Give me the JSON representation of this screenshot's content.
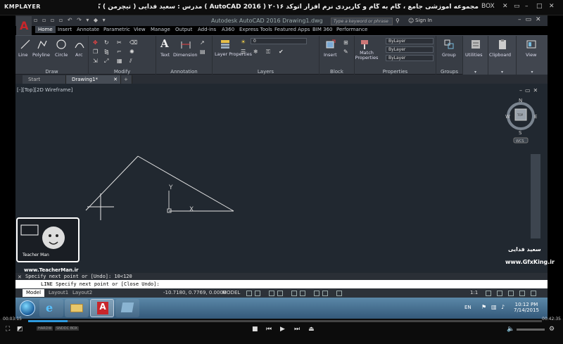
{
  "player": {
    "logo": "KMPLAYER",
    "title": "مجموعه آموزشی جامع ، گام به گام و کاربردی نرم افزار  اتوکد ۲۰۱۶ ( 2016 AutoCAD )   مدرس : سعید فدایی ( تیچرمن ) گروه آموزشی پادشاه گرافیست ها",
    "box_label": "BOX",
    "time_elapsed": "00:03:15",
    "time_total": "00:42:35",
    "progress": 0.077,
    "mode_labels": [
      "HARDW",
      "SNDDC BOX"
    ]
  },
  "autocad": {
    "app_letter": "A",
    "doc_title": "Autodesk AutoCAD 2016    Drawing1.dwg",
    "search_placeholder": "Type a keyword or phrase",
    "signin": "Sign In",
    "ribbon_tabs": [
      "Home",
      "Insert",
      "Annotate",
      "Parametric",
      "View",
      "Manage",
      "Output",
      "Add-ins",
      "A360",
      "Express Tools",
      "Featured Apps",
      "BIM 360",
      "Performance"
    ],
    "groups": {
      "draw": {
        "label": "Draw",
        "tools": [
          "Line",
          "Polyline",
          "Circle",
          "Arc"
        ]
      },
      "modify": {
        "label": "Modify"
      },
      "annotation": {
        "label": "Annotation",
        "tools": [
          "Text",
          "Dimension"
        ]
      },
      "layers": {
        "label": "Layers",
        "tools": [
          "Layer Properties"
        ],
        "layer_value": "0"
      },
      "block": {
        "label": "Block",
        "tools": [
          "Insert"
        ]
      },
      "properties": {
        "label": "Properties",
        "tools": [
          "Match Properties"
        ],
        "bylayer": [
          "ByLayer",
          "ByLayer",
          "ByLayer"
        ]
      },
      "groups": {
        "label": "Groups",
        "tools": [
          "Group"
        ]
      },
      "utilities": {
        "label": "Utilities"
      },
      "clipboard": {
        "label": "Clipboard"
      },
      "view": {
        "label": "View"
      }
    },
    "doc_tabs": [
      "Start",
      "Drawing1*"
    ],
    "viewport_label": "[-][Top][2D Wireframe]",
    "viewcube": {
      "top": "TOP",
      "n": "N",
      "s": "S",
      "e": "E",
      "w": "W",
      "wcs": "WCS"
    },
    "command_history": "Specify next point or [Undo]: 10<120",
    "command_line": "LINE Specify next point or [Close Undo]:",
    "layout_tabs": [
      "Model",
      "Layout1",
      "Layout2"
    ],
    "coords": "-10.7180, 0.7769, 0.0000",
    "model_label": "MODEL",
    "ucs_label_y": "Y",
    "ucs_label_x": "X",
    "zoom": "1:1"
  },
  "taskbar": {
    "lang": "EN",
    "time": "10:12 PM",
    "date": "7/14/2015"
  },
  "watermark": {
    "teacher_site": "www.TeacherMan.ir",
    "teacher_name": "Teacher Man",
    "gfx_site": "www.GfxKing.ir",
    "signature": "سعید فدایی"
  },
  "colors": {
    "ribbon": "#383d45",
    "viewport": "#212830",
    "accent": "#2e9bde",
    "autocad_red": "#c8262b"
  }
}
